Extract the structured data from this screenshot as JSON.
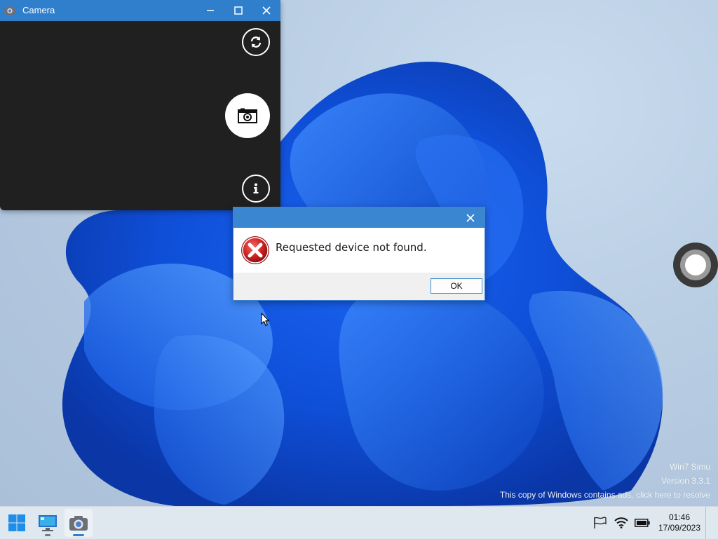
{
  "camera_window": {
    "title": "Camera",
    "buttons": {
      "minimize": "minimize-icon",
      "maximize": "maximize-icon",
      "close": "close-icon"
    },
    "controls": {
      "switch_camera": "switch-camera-icon",
      "capture": "camera-icon",
      "info": "info-icon"
    }
  },
  "dialog": {
    "message": "Requested device not found.",
    "ok_label": "OK",
    "icon": "error-icon"
  },
  "watermark": {
    "line1": "Win7 Simu",
    "line2": "Version 3.3.1",
    "line3": "This copy of Windows contains ads, click here to resolve"
  },
  "taskbar": {
    "items": [
      {
        "name": "start",
        "icon": "windows-start-icon"
      },
      {
        "name": "desktop",
        "icon": "computer-icon"
      },
      {
        "name": "camera",
        "icon": "camera-app-icon"
      }
    ],
    "tray": {
      "flag": "flag-icon",
      "wifi": "wifi-icon",
      "battery": "battery-icon"
    },
    "clock": {
      "time": "01:46",
      "date": "17/09/2023"
    }
  },
  "colors": {
    "accent": "#2f7fcd",
    "camera_bg": "#202020",
    "taskbar_bg": "#dfe7ef",
    "error_red": "#c62020"
  }
}
